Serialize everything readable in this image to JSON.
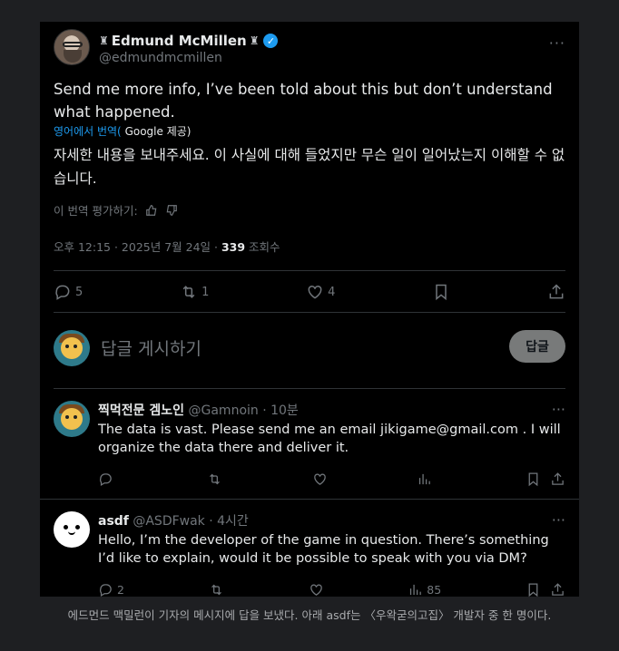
{
  "tweet": {
    "name": "Edmund McMillen",
    "handle": "@edmundmcmillen",
    "text": "Send me more info, I’ve been told about this but don’t understand what happened.",
    "translate_label": "영어에서 번역(",
    "translate_provider": " Google ",
    "translate_suffix": "제공)",
    "translated_text": "자세한 내용을 보내주세요. 이 사실에 대해 들었지만 무슨 일이 일어났는지 이해할 수 없습니다.",
    "rate_label": "이 번역 평가하기:",
    "timestamp": "오후 12:15 · 2025년 7월 24일 · ",
    "views_count": "339",
    "views_label": " 조회수",
    "replies": "5",
    "retweets": "1",
    "likes": "4"
  },
  "reply_box": {
    "placeholder": "답글 게시하기",
    "button_label": "답글"
  },
  "replies": [
    {
      "name": "찍먹전문 겜노인",
      "handle": "@Gamnoin · 10분",
      "text": "The data is vast. Please send me an email jikigame@gmail.com . I will organize the data there and deliver it.",
      "reply_count": "",
      "views": ""
    },
    {
      "name": "asdf",
      "handle": "@ASDFwak · 4시간",
      "text": "Hello, I’m the developer of the game in question. There’s something I’d like to explain, would it be possible to speak with you via DM?",
      "reply_count": "2",
      "views": "85"
    }
  ],
  "caption": "에드먼드 맥밀런이 기자의 메시지에 답을 보냈다. 아래 asdf는 〈우왁굳의고집〉 개발자 중 한 명이다.",
  "icons": [
    "chess-rook-icon",
    "verified-badge-icon",
    "more-icon",
    "reply-icon",
    "retweet-icon",
    "like-icon",
    "bookmark-icon",
    "share-icon",
    "views-icon",
    "thumbs-up-icon",
    "thumbs-down-icon"
  ],
  "colors": {
    "accent": "#1d9bf0",
    "background": "#000000",
    "muted": "#71767b",
    "page_bg": "#1e1f22"
  }
}
